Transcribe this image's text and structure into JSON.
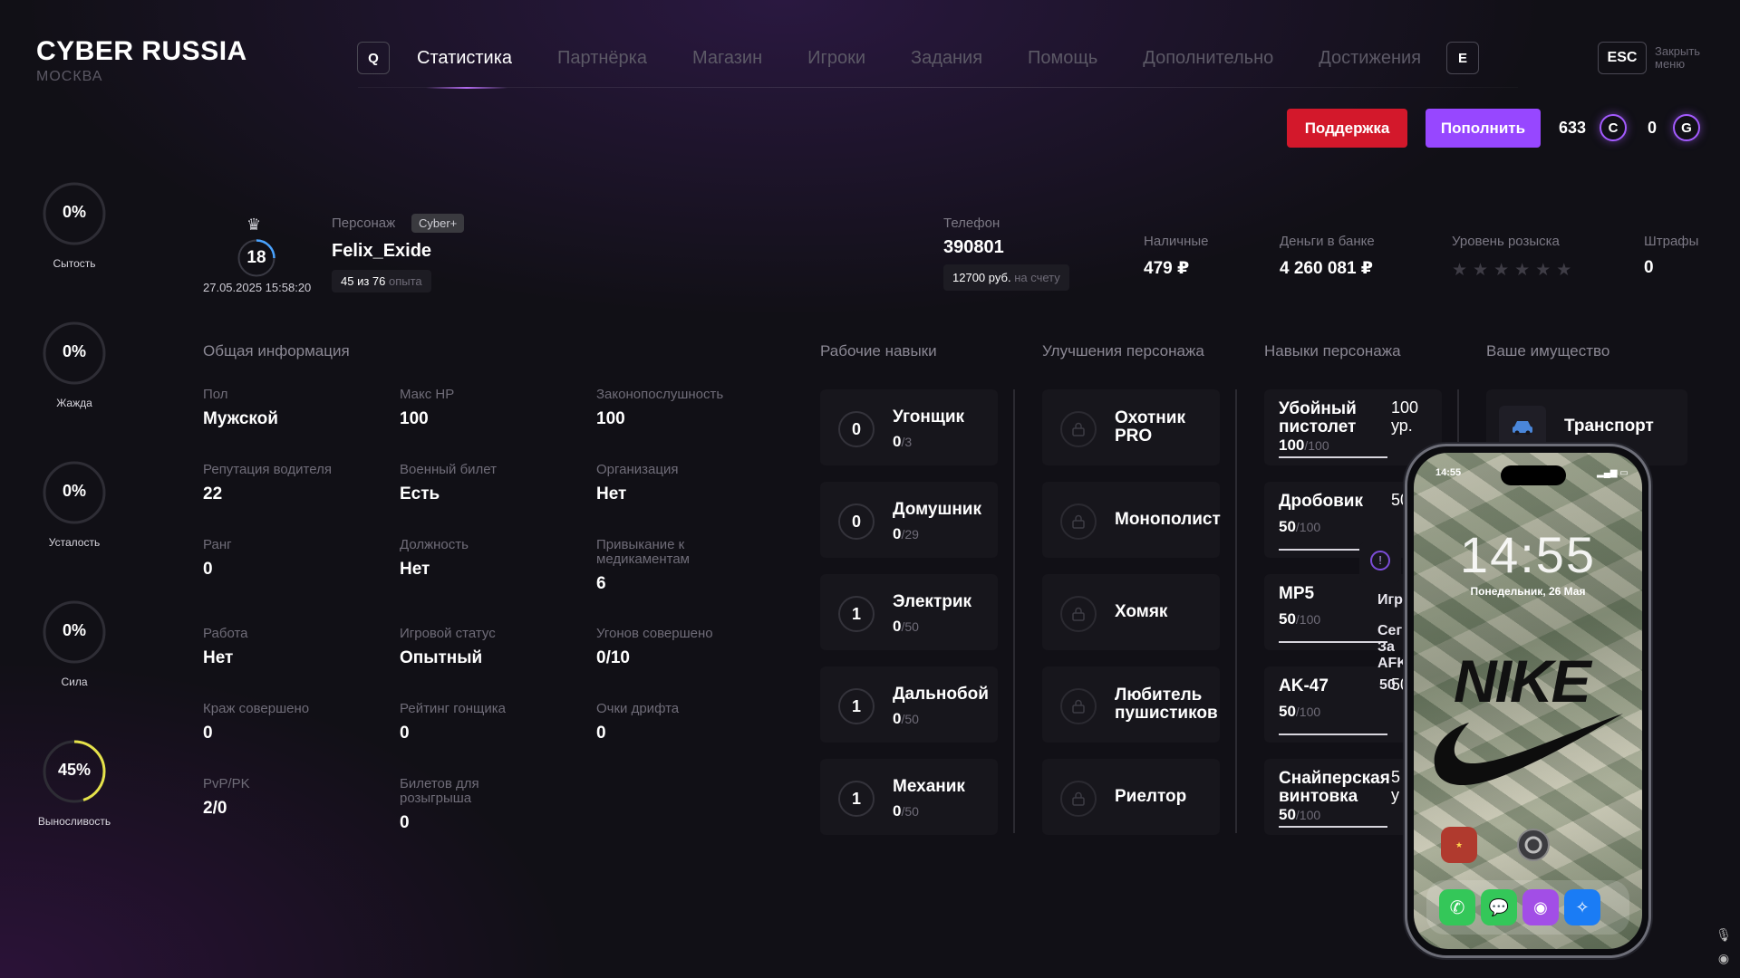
{
  "brand": {
    "title": "CYBER RUSSIA",
    "city": "МОСКВА"
  },
  "nav": {
    "left_key": "Q",
    "right_key": "E",
    "items": [
      "Статистика",
      "Партнёрка",
      "Магазин",
      "Игроки",
      "Задания",
      "Помощь",
      "Дополнительно",
      "Достижения"
    ],
    "active_index": 0,
    "esc_key": "ESC",
    "esc_label": "Закрыть меню"
  },
  "actions": {
    "support": "Поддержка",
    "topup": "Пополнить"
  },
  "currency": {
    "c_value": "633",
    "c_icon": "C",
    "g_value": "0",
    "g_icon": "G",
    "accent": "#a45bff"
  },
  "meters": [
    {
      "value": "0%",
      "label": "Сытость",
      "fraction": 0
    },
    {
      "value": "0%",
      "label": "Жажда",
      "fraction": 0
    },
    {
      "value": "0%",
      "label": "Усталость",
      "fraction": 0
    },
    {
      "value": "0%",
      "label": "Сила",
      "fraction": 0
    },
    {
      "value": "45%",
      "label": "Выносливость",
      "fraction": 0.45
    }
  ],
  "profile": {
    "level": "18",
    "date": "27.05.2025 15:58:20",
    "char_label": "Персонаж",
    "badge": "Cyber+",
    "name": "Felix_Exide",
    "exp_main": "45 из 76",
    "exp_suffix": "опыта"
  },
  "phone_info": {
    "label": "Телефон",
    "number": "390801",
    "account_main": "12700 руб.",
    "account_suffix": "на счету"
  },
  "stats": {
    "cash_label": "Наличные",
    "cash_value": "479 ₽",
    "bank_label": "Деньги в банке",
    "bank_value": "4 260 081 ₽",
    "wanted_label": "Уровень розыска",
    "wanted_stars": 0,
    "wanted_max": 6,
    "fines_label": "Штрафы",
    "fines_value": "0"
  },
  "general": {
    "title": "Общая информация",
    "items": [
      {
        "label": "Пол",
        "value": "Мужской"
      },
      {
        "label": "Макс HP",
        "value": "100"
      },
      {
        "label": "Законопослушность",
        "value": "100"
      },
      {
        "label": "Репутация водителя",
        "value": "22"
      },
      {
        "label": "Военный билет",
        "value": "Есть"
      },
      {
        "label": "Организация",
        "value": "Нет"
      },
      {
        "label": "Ранг",
        "value": "0"
      },
      {
        "label": "Должность",
        "value": "Нет"
      },
      {
        "label": "Привыкание к медикаментам",
        "value": "6"
      },
      {
        "label": "Работа",
        "value": "Нет"
      },
      {
        "label": "Игровой статус",
        "value": "Опытный"
      },
      {
        "label": "Угонов совершено",
        "value": "0/10"
      },
      {
        "label": "Краж совершено",
        "value": "0"
      },
      {
        "label": "Рейтинг гонщика",
        "value": "0"
      },
      {
        "label": "Очки дрифта",
        "value": "0"
      },
      {
        "label": "PvP/PK",
        "value": "2/0"
      },
      {
        "label": "Билетов для розыгрыша",
        "value": "0"
      }
    ]
  },
  "work_skills": {
    "title": "Рабочие навыки",
    "items": [
      {
        "level": "0",
        "name": "Угонщик",
        "current": "0",
        "max": "/3"
      },
      {
        "level": "0",
        "name": "Домушник",
        "current": "0",
        "max": "/29"
      },
      {
        "level": "1",
        "name": "Электрик",
        "current": "0",
        "max": "/50"
      },
      {
        "level": "1",
        "name": "Дальнобой",
        "current": "0",
        "max": "/50"
      },
      {
        "level": "1",
        "name": "Механик",
        "current": "0",
        "max": "/50"
      }
    ]
  },
  "upgrades": {
    "title": "Улучшения персонажа",
    "items": [
      {
        "name1": "Охотник",
        "name2": "PRO"
      },
      {
        "name1": "Монополист",
        "name2": ""
      },
      {
        "name1": "Хомяк",
        "name2": ""
      },
      {
        "name1": "Любитель",
        "name2": "пушистиков"
      },
      {
        "name1": "Риелтор",
        "name2": ""
      }
    ]
  },
  "char_skills": {
    "title": "Навыки персонажа",
    "items": [
      {
        "name1": "Убойный",
        "name2": "пистолет",
        "current": "100",
        "max": "/100",
        "lvl1": "100",
        "lvl2": "ур."
      },
      {
        "name1": "Дробовик",
        "name2": "",
        "current": "50",
        "max": "/100",
        "lvl1": "50",
        "lvl2": ""
      },
      {
        "name1": "MP5",
        "name2": "",
        "current": "50",
        "max": "/100",
        "lvl1": "",
        "lvl2": ""
      },
      {
        "name1": "AK-47",
        "name2": "",
        "current": "50",
        "max": "/100",
        "lvl1": "50",
        "lvl2": ""
      },
      {
        "name1": "Снайперская",
        "name2": "винтовка",
        "current": "50",
        "max": "/100",
        "lvl1": "5",
        "lvl2": "у"
      }
    ]
  },
  "property": {
    "title": "Ваше имущество",
    "item": "Транспорт"
  },
  "overlay_fragments": {
    "a": "Игр",
    "b1": "Сег",
    "b2": "За",
    "b3": "AFK",
    "c": "50"
  },
  "phone_overlay": {
    "status_time": "14:55",
    "clock": "14:55",
    "date": "Понедельник, 26 Мая",
    "wallpaper_text": "NIKE"
  }
}
